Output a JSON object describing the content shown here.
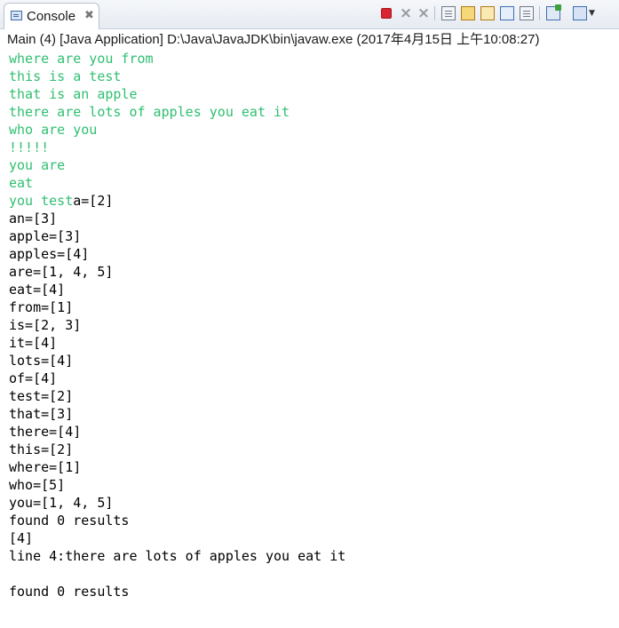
{
  "tab": {
    "label": "Console",
    "close": "✖",
    "icon": "console-icon"
  },
  "toolbar": {
    "icons": [
      "terminate-icon",
      "remove-launch-icon",
      "remove-all-terminated-icon",
      "clear-console-icon",
      "scroll-lock-icon",
      "word-wrap-icon",
      "show-when-stdout-icon",
      "show-when-stderr-icon",
      "pin-console-icon",
      "open-console-icon",
      "display-console-icon"
    ],
    "stop_color": "#d9232f"
  },
  "header": {
    "text": "Main (4) [Java Application] D:\\Java\\JavaJDK\\bin\\javaw.exe (2017年4月15日 上午10:08:27)"
  },
  "colors": {
    "input": "#2fbf71",
    "output": "#000000"
  },
  "console": {
    "input_lines": [
      "where are you from",
      "this is a test",
      "that is an apple",
      "there are lots of apples you eat it",
      "who are you",
      "!!!!!",
      "you are",
      "eat",
      "you test"
    ],
    "inline_output": "a=[2]",
    "output_lines": [
      "an=[3]",
      "apple=[3]",
      "apples=[4]",
      "are=[1, 4, 5]",
      "eat=[4]",
      "from=[1]",
      "is=[2, 3]",
      "it=[4]",
      "lots=[4]",
      "of=[4]",
      "test=[2]",
      "that=[3]",
      "there=[4]",
      "this=[2]",
      "where=[1]",
      "who=[5]",
      "you=[1, 4, 5]",
      "found 0 results",
      "[4]",
      "line 4:there are lots of apples you eat it",
      "",
      "found 0 results"
    ]
  }
}
